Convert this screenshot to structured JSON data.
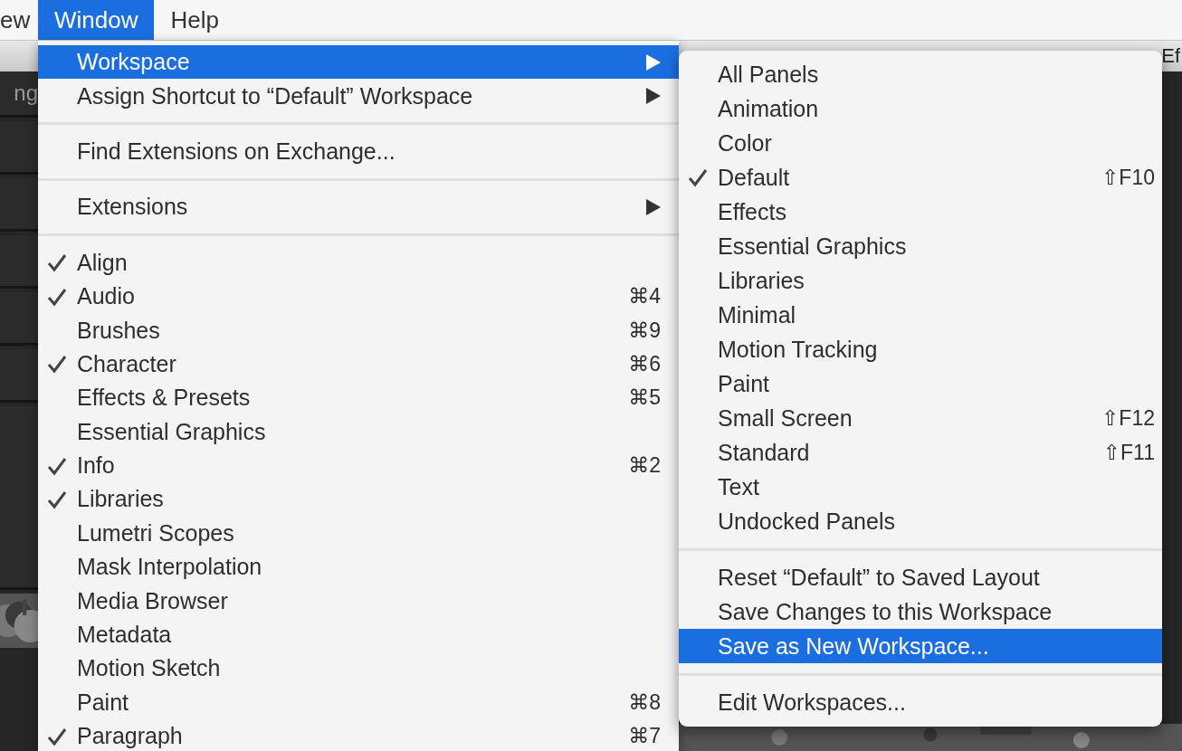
{
  "menubar": [
    {
      "label": "ew",
      "selected": false
    },
    {
      "label": "Window",
      "selected": true
    },
    {
      "label": "Help",
      "selected": false
    }
  ],
  "app_window": {
    "title": "Ef",
    "panel_tab": "ng"
  },
  "window_menu": {
    "items": [
      {
        "kind": "item",
        "label": "Workspace",
        "submenu": true,
        "selected": true,
        "checked": false
      },
      {
        "kind": "item",
        "label": "Assign Shortcut to “Default” Workspace",
        "submenu": true,
        "selected": false,
        "checked": false
      },
      {
        "kind": "separator"
      },
      {
        "kind": "item",
        "label": "Find Extensions on Exchange...",
        "submenu": false,
        "selected": false,
        "checked": false
      },
      {
        "kind": "separator"
      },
      {
        "kind": "item",
        "label": "Extensions",
        "submenu": true,
        "selected": false,
        "checked": false
      },
      {
        "kind": "separator"
      },
      {
        "kind": "item",
        "label": "Align",
        "submenu": false,
        "selected": false,
        "checked": true
      },
      {
        "kind": "item",
        "label": "Audio",
        "shortcut": "⌘4",
        "submenu": false,
        "selected": false,
        "checked": true
      },
      {
        "kind": "item",
        "label": "Brushes",
        "shortcut": "⌘9",
        "submenu": false,
        "selected": false,
        "checked": false
      },
      {
        "kind": "item",
        "label": "Character",
        "shortcut": "⌘6",
        "submenu": false,
        "selected": false,
        "checked": true
      },
      {
        "kind": "item",
        "label": "Effects & Presets",
        "shortcut": "⌘5",
        "submenu": false,
        "selected": false,
        "checked": false
      },
      {
        "kind": "item",
        "label": "Essential Graphics",
        "submenu": false,
        "selected": false,
        "checked": false
      },
      {
        "kind": "item",
        "label": "Info",
        "shortcut": "⌘2",
        "submenu": false,
        "selected": false,
        "checked": true
      },
      {
        "kind": "item",
        "label": "Libraries",
        "submenu": false,
        "selected": false,
        "checked": true
      },
      {
        "kind": "item",
        "label": "Lumetri Scopes",
        "submenu": false,
        "selected": false,
        "checked": false
      },
      {
        "kind": "item",
        "label": "Mask Interpolation",
        "submenu": false,
        "selected": false,
        "checked": false
      },
      {
        "kind": "item",
        "label": "Media Browser",
        "submenu": false,
        "selected": false,
        "checked": false
      },
      {
        "kind": "item",
        "label": "Metadata",
        "submenu": false,
        "selected": false,
        "checked": false
      },
      {
        "kind": "item",
        "label": "Motion Sketch",
        "submenu": false,
        "selected": false,
        "checked": false
      },
      {
        "kind": "item",
        "label": "Paint",
        "shortcut": "⌘8",
        "submenu": false,
        "selected": false,
        "checked": false
      },
      {
        "kind": "item",
        "label": "Paragraph",
        "shortcut": "⌘7",
        "submenu": false,
        "selected": false,
        "checked": true
      }
    ]
  },
  "workspace_submenu": {
    "items": [
      {
        "kind": "item",
        "label": "All Panels",
        "selected": false,
        "checked": false
      },
      {
        "kind": "item",
        "label": "Animation",
        "selected": false,
        "checked": false
      },
      {
        "kind": "item",
        "label": "Color",
        "selected": false,
        "checked": false
      },
      {
        "kind": "item",
        "label": "Default",
        "shortcut": "⇧F10",
        "selected": false,
        "checked": true
      },
      {
        "kind": "item",
        "label": "Effects",
        "selected": false,
        "checked": false
      },
      {
        "kind": "item",
        "label": "Essential Graphics",
        "selected": false,
        "checked": false
      },
      {
        "kind": "item",
        "label": "Libraries",
        "selected": false,
        "checked": false
      },
      {
        "kind": "item",
        "label": "Minimal",
        "selected": false,
        "checked": false
      },
      {
        "kind": "item",
        "label": "Motion Tracking",
        "selected": false,
        "checked": false
      },
      {
        "kind": "item",
        "label": "Paint",
        "selected": false,
        "checked": false
      },
      {
        "kind": "item",
        "label": "Small Screen",
        "shortcut": "⇧F12",
        "selected": false,
        "checked": false
      },
      {
        "kind": "item",
        "label": "Standard",
        "shortcut": "⇧F11",
        "selected": false,
        "checked": false
      },
      {
        "kind": "item",
        "label": "Text",
        "selected": false,
        "checked": false
      },
      {
        "kind": "item",
        "label": "Undocked Panels",
        "selected": false,
        "checked": false
      },
      {
        "kind": "separator"
      },
      {
        "kind": "item",
        "label": "Reset “Default” to Saved Layout",
        "selected": false,
        "checked": false
      },
      {
        "kind": "item",
        "label": "Save Changes to this Workspace",
        "selected": false,
        "checked": false
      },
      {
        "kind": "item",
        "label": "Save as New Workspace...",
        "selected": true,
        "checked": false
      },
      {
        "kind": "separator"
      },
      {
        "kind": "item",
        "label": "Edit Workspaces...",
        "selected": false,
        "checked": false
      }
    ]
  }
}
